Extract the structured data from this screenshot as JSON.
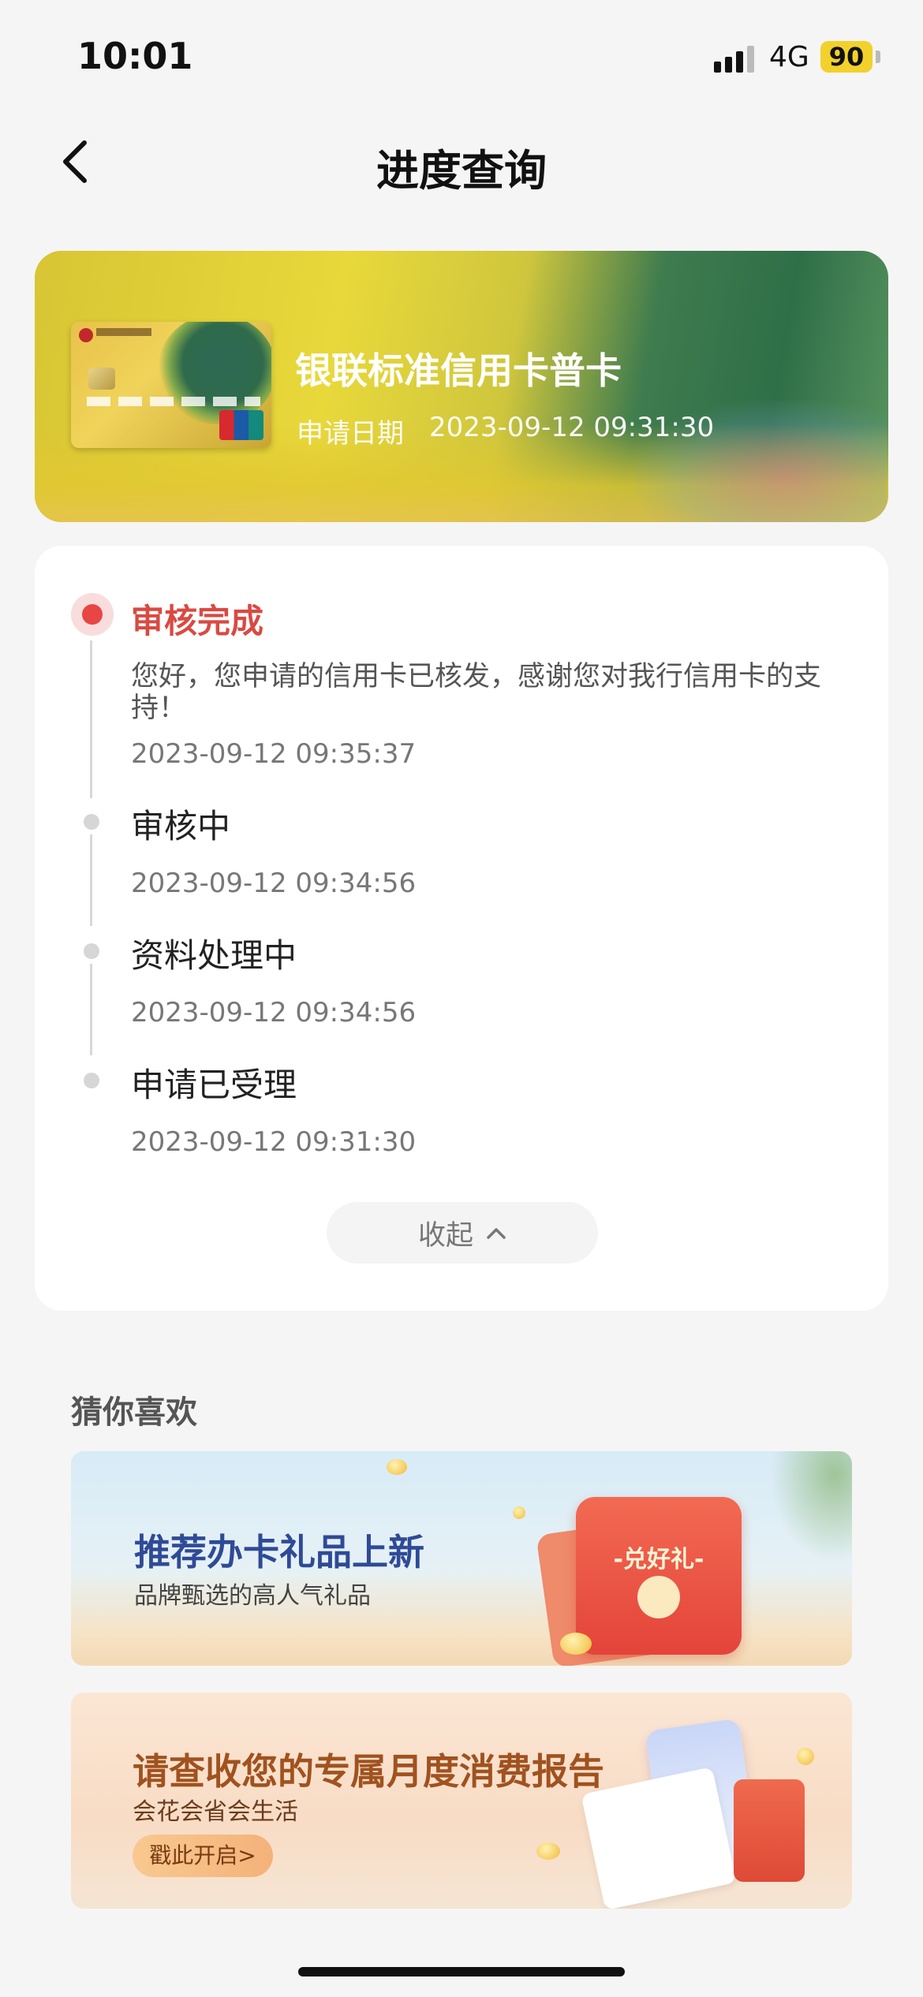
{
  "status_bar": {
    "time": "10:01",
    "network": "4G",
    "battery": "90"
  },
  "nav": {
    "title": "进度查询"
  },
  "card": {
    "name": "银联标准信用卡普卡",
    "date_label": "申请日期",
    "date_value": "2023-09-12 09:31:30"
  },
  "progress": {
    "steps": [
      {
        "title": "审核完成",
        "desc": "您好，您申请的信用卡已核发，感谢您对我行信用卡的支持！",
        "time": "2023-09-12 09:35:37",
        "active": true
      },
      {
        "title": "审核中",
        "time": "2023-09-12 09:34:56"
      },
      {
        "title": "资料处理中",
        "time": "2023-09-12 09:34:56"
      },
      {
        "title": "申请已受理",
        "time": "2023-09-12 09:31:30"
      }
    ],
    "collapse_label": "收起"
  },
  "recommend": {
    "title": "猜你喜欢",
    "banners": [
      {
        "heading": "推荐办卡礼品上新",
        "sub": "品牌甄选的高人气礼品",
        "tag": "-兑好礼-"
      },
      {
        "heading": "请查收您的专属月度消费报告",
        "sub": "会花会省会生活",
        "cta": "戳此开启>"
      }
    ]
  },
  "colors": {
    "accent": "#d94a42",
    "active_dot": "#e84545",
    "inactive": "#d6d6d6"
  }
}
